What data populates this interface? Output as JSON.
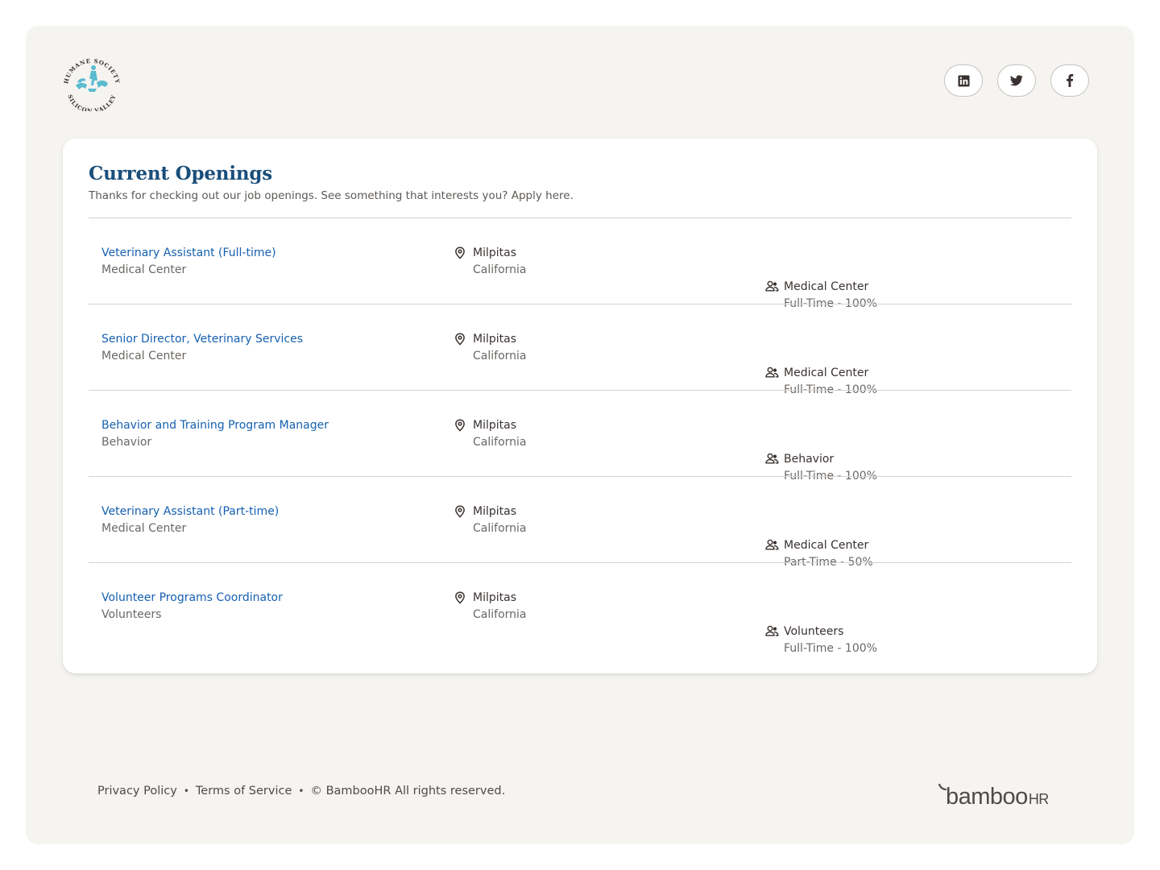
{
  "brand": {
    "logo_top_text": "HUMANE SOCIETY",
    "logo_bottom_text": "SILICON VALLEY",
    "logo_color": "#5bbcd0"
  },
  "social": {
    "linkedin": "linkedin-icon",
    "twitter": "twitter-icon",
    "facebook": "facebook-icon"
  },
  "openings": {
    "title": "Current Openings",
    "subtitle": "Thanks for checking out our job openings. See something that interests you? Apply here.",
    "jobs": [
      {
        "title": "Veterinary Assistant (Full-time)",
        "department": "Medical Center",
        "city": "Milpitas",
        "state": "California",
        "team": "Medical Center",
        "employment": "Full-Time - 100%"
      },
      {
        "title": "Senior Director, Veterinary Services",
        "department": "Medical Center",
        "city": "Milpitas",
        "state": "California",
        "team": "Medical Center",
        "employment": "Full-Time - 100%"
      },
      {
        "title": "Behavior and Training Program Manager",
        "department": "Behavior",
        "city": "Milpitas",
        "state": "California",
        "team": "Behavior",
        "employment": "Full-Time - 100%"
      },
      {
        "title": "Veterinary Assistant (Part-time)",
        "department": "Medical Center",
        "city": "Milpitas",
        "state": "California",
        "team": "Medical Center",
        "employment": "Part-Time - 50%"
      },
      {
        "title": "Volunteer Programs Coordinator",
        "department": "Volunteers",
        "city": "Milpitas",
        "state": "California",
        "team": "Volunteers",
        "employment": "Full-Time - 100%"
      }
    ]
  },
  "footer": {
    "privacy": "Privacy Policy",
    "terms": "Terms of Service",
    "copyright": "© BambooHR All rights reserved.",
    "bamboo_logo_text": "bambooHR"
  },
  "colors": {
    "accent": "#1560b0",
    "title": "#1a4e7a",
    "background": "#f5f4f1"
  }
}
